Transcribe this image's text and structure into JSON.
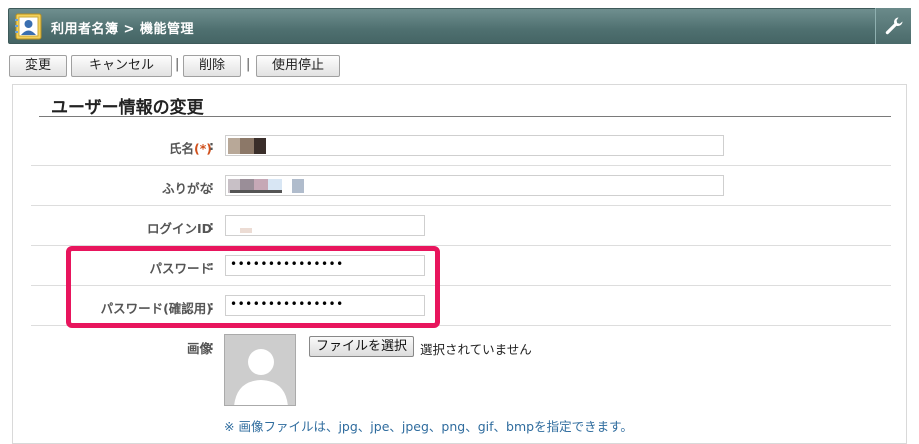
{
  "header": {
    "title": "利用者名簿 > 機能管理",
    "app_icon": "address-book-icon",
    "settings_icon": "wrench-icon"
  },
  "toolbar": {
    "buttons": [
      "変更",
      "キャンセル",
      "削除",
      "使用停止"
    ],
    "separator": "|"
  },
  "form": {
    "section_title": "ユーザー情報の変更",
    "colon": ":",
    "name_label": "氏名",
    "required_mark": "(*)",
    "furigana_label": "ふりがな",
    "login_label": "ログインID",
    "password_label": "パスワード",
    "password_confirm_label": "パスワード(確認用)",
    "password_value": "•••••••••••••••",
    "password_confirm_value": "•••••••••••••••",
    "image_label": "画像",
    "file_button_label": "ファイルを選択",
    "file_status": "選択されていません",
    "image_note": "※ 画像ファイルは、jpg、jpe、jpeg、png、gif、bmpを指定できます。"
  },
  "colors": {
    "header_bg": "#4f7070",
    "highlight": "#e8155d",
    "required": "#d0501c",
    "note": "#2f6c9e"
  }
}
